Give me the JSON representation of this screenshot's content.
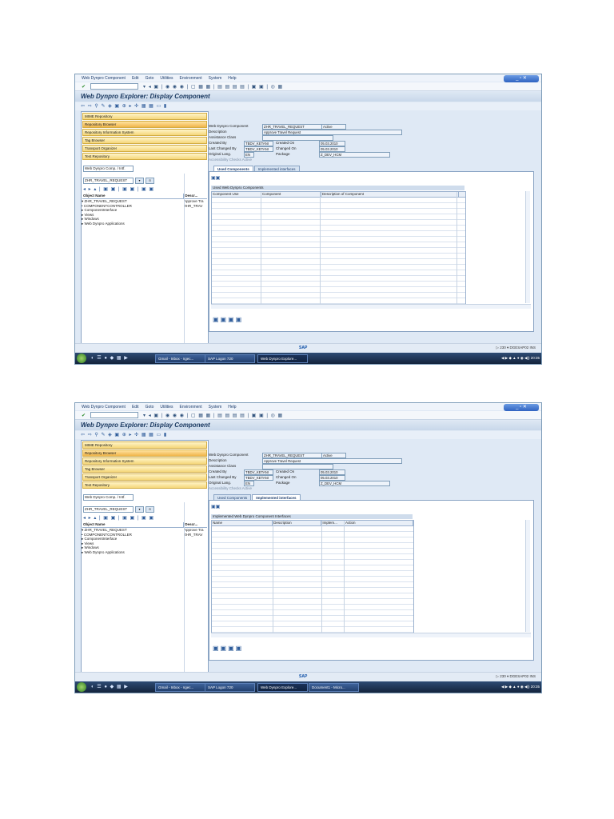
{
  "shared": {
    "menu": [
      "Web Dynpro Component",
      "Edit",
      "Goto",
      "Utilities",
      "Environment",
      "System",
      "Help"
    ],
    "title": "Web Dynpro Explorer: Display Component",
    "nav": [
      "MIME Repository",
      "Repository Browser",
      "Repository Information System",
      "Tag Browser",
      "Transport Organizer",
      "Test Repository"
    ],
    "object_type": "Web Dynpro Comp. / Intf.",
    "object_name": "ZHR_TRAVEL_REQUEST",
    "tree_headers": [
      "Object Name",
      "Descr..."
    ],
    "tree": [
      {
        "name": "▾ ZHR_TRAVEL_REQUEST",
        "desc": "Approve Tra"
      },
      {
        "name": "   • COMPONENTCONTROLLER",
        "desc": "ZHR_TRAV"
      },
      {
        "name": "   ▸ ComponentInterface",
        "desc": ""
      },
      {
        "name": "   ▸ Views",
        "desc": ""
      },
      {
        "name": "   ▸ Windows",
        "desc": ""
      },
      {
        "name": "   ▸ Web Dynpro Applications",
        "desc": ""
      }
    ],
    "fields": {
      "wdc_label": "Web Dynpro Component",
      "wdc_value": "ZHR_TRAVEL_REQUEST",
      "status": "Active",
      "desc_label": "Description",
      "desc_value": "Approve Travel Request",
      "assist_label": "Assistance Class",
      "created_by_label": "Created By",
      "created_by": "TBDV_KETANI",
      "created_on_label": "Created On",
      "created_on": "05.03.2010",
      "changed_by_label": "Last Changed By",
      "changed_by": "TBDV_KETANI",
      "changed_on_label": "Changed On",
      "changed_on": "05.03.2010",
      "lang_label": "Original Lang.",
      "lang": "EN",
      "package_label": "Package",
      "package": "Z_DEV_HCM",
      "access_label": "Accessibility Checks Active"
    },
    "tabs": [
      "Used Components",
      "Implemented interfaces"
    ],
    "status_logo": "SAP",
    "status_sys": "▷ 230 ▾ DGESAP02 INS",
    "quick_icons": "◐ ☰ ● ◆ ▦ ▶",
    "tray1": "◀ ▶ ◆ ▲ ● ◉ ◀)) 20:35",
    "tray2": "◀ ▶ ◆ ▲ ● ◉ ◀)) 20:35"
  },
  "shot1": {
    "grid_title": "Used Web Dynpro Components",
    "grid_headers": [
      "Component Use",
      "Component",
      "Description of Component"
    ],
    "tasks": [
      "Gmail - Inbox - ngec...",
      "SAP Logon 720",
      "Web Dynpro Explore..."
    ]
  },
  "shot2": {
    "grid_title": "Implemented Web Dynpro Component Interfaces",
    "grid_headers": [
      "Name",
      "Description",
      "Implem...",
      "Action"
    ],
    "tasks": [
      "Gmail - Inbox - ngec...",
      "SAP Logon 720",
      "Web Dynpro Explore...",
      "Document1 - Micro..."
    ]
  }
}
